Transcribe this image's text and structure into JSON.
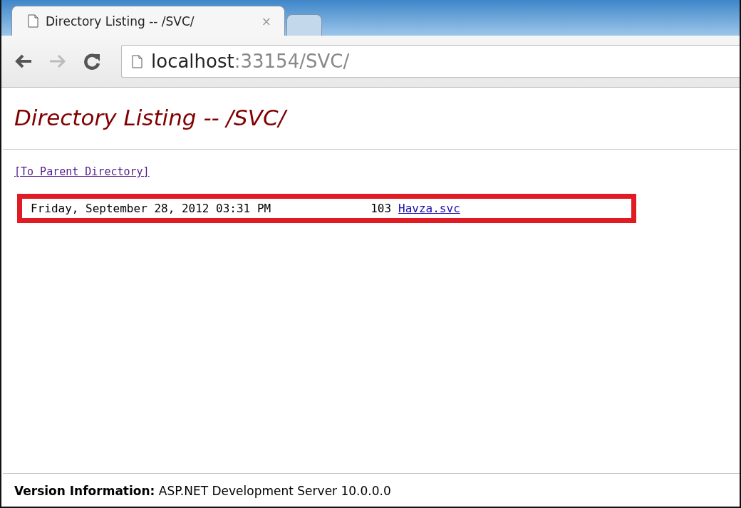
{
  "tabs": [
    {
      "title": "Directory Listing -- /SVC/",
      "close": "×",
      "selected": true
    },
    {
      "selected": false
    }
  ],
  "address": {
    "host": "localhost",
    "rest": ":33154/SVC/"
  },
  "page": {
    "heading": "Directory Listing -- /SVC/",
    "parent_link": "[To Parent Directory]",
    "files": [
      {
        "date": "Friday, September 28, 2012 03:31 PM",
        "size": "103",
        "name": "Havza.svc",
        "highlighted": true
      }
    ]
  },
  "footer": "**Version Information:** ASP.NET Development Server 10.0.0.0"
}
